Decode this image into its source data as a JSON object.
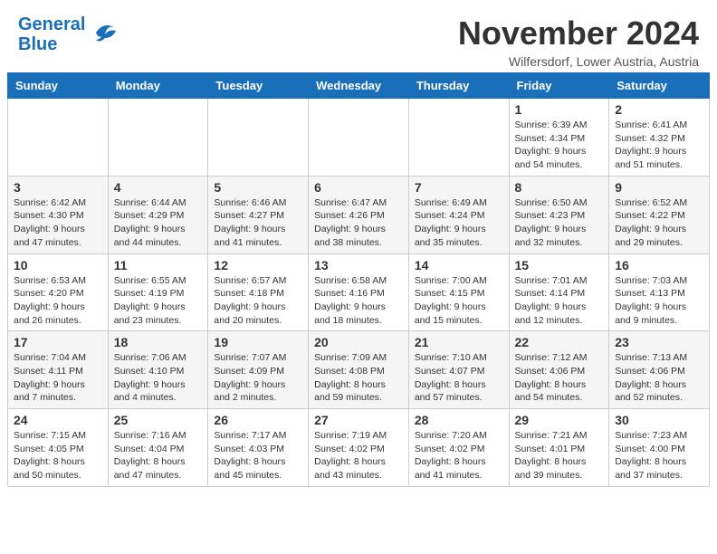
{
  "header": {
    "logo_line1": "General",
    "logo_line2": "Blue",
    "month": "November 2024",
    "location": "Wilfersdorf, Lower Austria, Austria"
  },
  "weekdays": [
    "Sunday",
    "Monday",
    "Tuesday",
    "Wednesday",
    "Thursday",
    "Friday",
    "Saturday"
  ],
  "weeks": [
    [
      {
        "day": "",
        "info": ""
      },
      {
        "day": "",
        "info": ""
      },
      {
        "day": "",
        "info": ""
      },
      {
        "day": "",
        "info": ""
      },
      {
        "day": "",
        "info": ""
      },
      {
        "day": "1",
        "info": "Sunrise: 6:39 AM\nSunset: 4:34 PM\nDaylight: 9 hours\nand 54 minutes."
      },
      {
        "day": "2",
        "info": "Sunrise: 6:41 AM\nSunset: 4:32 PM\nDaylight: 9 hours\nand 51 minutes."
      }
    ],
    [
      {
        "day": "3",
        "info": "Sunrise: 6:42 AM\nSunset: 4:30 PM\nDaylight: 9 hours\nand 47 minutes."
      },
      {
        "day": "4",
        "info": "Sunrise: 6:44 AM\nSunset: 4:29 PM\nDaylight: 9 hours\nand 44 minutes."
      },
      {
        "day": "5",
        "info": "Sunrise: 6:46 AM\nSunset: 4:27 PM\nDaylight: 9 hours\nand 41 minutes."
      },
      {
        "day": "6",
        "info": "Sunrise: 6:47 AM\nSunset: 4:26 PM\nDaylight: 9 hours\nand 38 minutes."
      },
      {
        "day": "7",
        "info": "Sunrise: 6:49 AM\nSunset: 4:24 PM\nDaylight: 9 hours\nand 35 minutes."
      },
      {
        "day": "8",
        "info": "Sunrise: 6:50 AM\nSunset: 4:23 PM\nDaylight: 9 hours\nand 32 minutes."
      },
      {
        "day": "9",
        "info": "Sunrise: 6:52 AM\nSunset: 4:22 PM\nDaylight: 9 hours\nand 29 minutes."
      }
    ],
    [
      {
        "day": "10",
        "info": "Sunrise: 6:53 AM\nSunset: 4:20 PM\nDaylight: 9 hours\nand 26 minutes."
      },
      {
        "day": "11",
        "info": "Sunrise: 6:55 AM\nSunset: 4:19 PM\nDaylight: 9 hours\nand 23 minutes."
      },
      {
        "day": "12",
        "info": "Sunrise: 6:57 AM\nSunset: 4:18 PM\nDaylight: 9 hours\nand 20 minutes."
      },
      {
        "day": "13",
        "info": "Sunrise: 6:58 AM\nSunset: 4:16 PM\nDaylight: 9 hours\nand 18 minutes."
      },
      {
        "day": "14",
        "info": "Sunrise: 7:00 AM\nSunset: 4:15 PM\nDaylight: 9 hours\nand 15 minutes."
      },
      {
        "day": "15",
        "info": "Sunrise: 7:01 AM\nSunset: 4:14 PM\nDaylight: 9 hours\nand 12 minutes."
      },
      {
        "day": "16",
        "info": "Sunrise: 7:03 AM\nSunset: 4:13 PM\nDaylight: 9 hours\nand 9 minutes."
      }
    ],
    [
      {
        "day": "17",
        "info": "Sunrise: 7:04 AM\nSunset: 4:11 PM\nDaylight: 9 hours\nand 7 minutes."
      },
      {
        "day": "18",
        "info": "Sunrise: 7:06 AM\nSunset: 4:10 PM\nDaylight: 9 hours\nand 4 minutes."
      },
      {
        "day": "19",
        "info": "Sunrise: 7:07 AM\nSunset: 4:09 PM\nDaylight: 9 hours\nand 2 minutes."
      },
      {
        "day": "20",
        "info": "Sunrise: 7:09 AM\nSunset: 4:08 PM\nDaylight: 8 hours\nand 59 minutes."
      },
      {
        "day": "21",
        "info": "Sunrise: 7:10 AM\nSunset: 4:07 PM\nDaylight: 8 hours\nand 57 minutes."
      },
      {
        "day": "22",
        "info": "Sunrise: 7:12 AM\nSunset: 4:06 PM\nDaylight: 8 hours\nand 54 minutes."
      },
      {
        "day": "23",
        "info": "Sunrise: 7:13 AM\nSunset: 4:06 PM\nDaylight: 8 hours\nand 52 minutes."
      }
    ],
    [
      {
        "day": "24",
        "info": "Sunrise: 7:15 AM\nSunset: 4:05 PM\nDaylight: 8 hours\nand 50 minutes."
      },
      {
        "day": "25",
        "info": "Sunrise: 7:16 AM\nSunset: 4:04 PM\nDaylight: 8 hours\nand 47 minutes."
      },
      {
        "day": "26",
        "info": "Sunrise: 7:17 AM\nSunset: 4:03 PM\nDaylight: 8 hours\nand 45 minutes."
      },
      {
        "day": "27",
        "info": "Sunrise: 7:19 AM\nSunset: 4:02 PM\nDaylight: 8 hours\nand 43 minutes."
      },
      {
        "day": "28",
        "info": "Sunrise: 7:20 AM\nSunset: 4:02 PM\nDaylight: 8 hours\nand 41 minutes."
      },
      {
        "day": "29",
        "info": "Sunrise: 7:21 AM\nSunset: 4:01 PM\nDaylight: 8 hours\nand 39 minutes."
      },
      {
        "day": "30",
        "info": "Sunrise: 7:23 AM\nSunset: 4:00 PM\nDaylight: 8 hours\nand 37 minutes."
      }
    ]
  ]
}
